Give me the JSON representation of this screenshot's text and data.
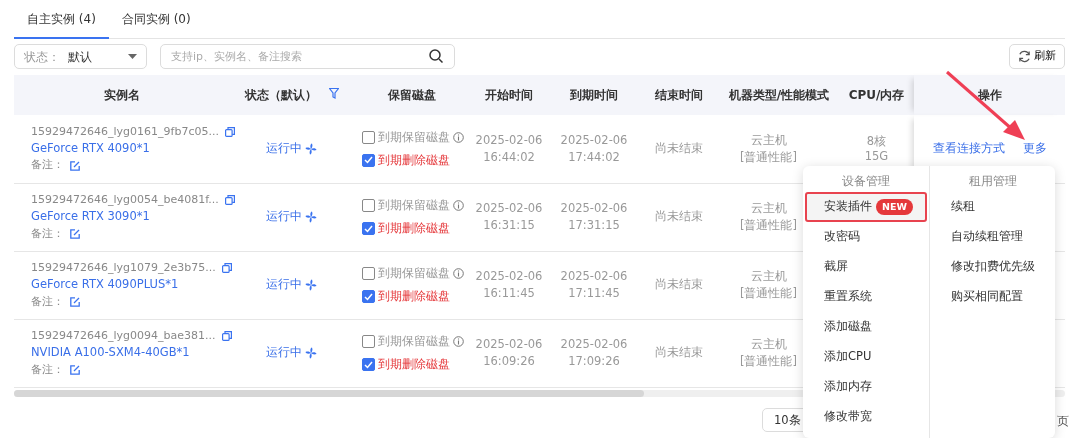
{
  "tabs": [
    {
      "label": "自主实例 (4)",
      "selected": true
    },
    {
      "label": "合同实例 (0)",
      "selected": false
    }
  ],
  "filters": {
    "status_label": "状态：",
    "status_value": "默认",
    "search_placeholder": "支持ip、实例名、备注搜索",
    "refresh_label": "刷新"
  },
  "table": {
    "columns": [
      "实例名",
      "状态（默认）",
      "保留磁盘",
      "开始时间",
      "到期时间",
      "结束时间",
      "机器类型/性能模式",
      "CPU/内存",
      "操作"
    ],
    "rows": [
      {
        "instance_id": "15929472646_lyg0161_9fb7c05...",
        "gpu": "GeForce RTX 4090*1",
        "note_label": "备注：",
        "status": "运行中",
        "keep_disk": {
          "label": "到期保留磁盘",
          "checked": false
        },
        "delete_disk": {
          "label": "到期删除磁盘",
          "checked": true
        },
        "start": [
          "2025-02-06",
          "16:44:02"
        ],
        "expire": [
          "2025-02-06",
          "17:44:02"
        ],
        "end": "尚未结束",
        "machine": [
          "云主机",
          "[普通性能]"
        ],
        "cpu_memory": [
          "8核",
          "15G"
        ],
        "actions": [
          "查看连接方式",
          "更多"
        ]
      },
      {
        "instance_id": "15929472646_lyg0054_be4081f...",
        "gpu": "GeForce RTX 3090*1",
        "note_label": "备注：",
        "status": "运行中",
        "keep_disk": {
          "label": "到期保留磁盘",
          "checked": false
        },
        "delete_disk": {
          "label": "到期删除磁盘",
          "checked": true
        },
        "start": [
          "2025-02-06",
          "16:31:15"
        ],
        "expire": [
          "2025-02-06",
          "17:31:15"
        ],
        "end": "尚未结束",
        "machine": [
          "云主机",
          "[普通性能]"
        ]
      },
      {
        "instance_id": "15929472646_lyg1079_2e3b75...",
        "gpu": "GeForce RTX 4090PLUS*1",
        "note_label": "备注：",
        "status": "运行中",
        "keep_disk": {
          "label": "到期保留磁盘",
          "checked": false
        },
        "delete_disk": {
          "label": "到期删除磁盘",
          "checked": true
        },
        "start": [
          "2025-02-06",
          "16:11:45"
        ],
        "expire": [
          "2025-02-06",
          "17:11:45"
        ],
        "end": "尚未结束",
        "machine": [
          "云主机",
          "[普通性能]"
        ]
      },
      {
        "instance_id": "15929472646_lyg0094_bae381...",
        "gpu": "NVIDIA A100-SXM4-40GB*1",
        "note_label": "备注：",
        "status": "运行中",
        "keep_disk": {
          "label": "到期保留磁盘",
          "checked": false
        },
        "delete_disk": {
          "label": "到期删除磁盘",
          "checked": true
        },
        "start": [
          "2025-02-06",
          "16:09:26"
        ],
        "expire": [
          "2025-02-06",
          "17:09:26"
        ],
        "end": "尚未结束",
        "machine": [
          "云主机",
          "[普通性能]"
        ]
      }
    ]
  },
  "pagination": {
    "page_size": "10条",
    "suffix": "页"
  },
  "menu": {
    "groups": [
      {
        "title": "设备管理",
        "items": [
          {
            "label": "安装插件",
            "badge": "NEW",
            "highlighted": true
          },
          {
            "label": "改密码",
            "highlighted": false
          },
          {
            "label": "截屏",
            "highlighted": false
          },
          {
            "label": "重置系统",
            "highlighted": false
          },
          {
            "label": "添加磁盘",
            "highlighted": false
          },
          {
            "label": "添加CPU",
            "highlighted": false
          },
          {
            "label": "添加内存",
            "highlighted": false
          },
          {
            "label": "修改带宽",
            "highlighted": false
          }
        ]
      },
      {
        "title": "租用管理",
        "items": [
          {
            "label": "续租",
            "highlighted": false
          },
          {
            "label": "自动续租管理",
            "highlighted": false
          },
          {
            "label": "修改扣费优先级",
            "highlighted": false
          },
          {
            "label": "购买相同配置",
            "highlighted": false
          }
        ]
      }
    ]
  }
}
